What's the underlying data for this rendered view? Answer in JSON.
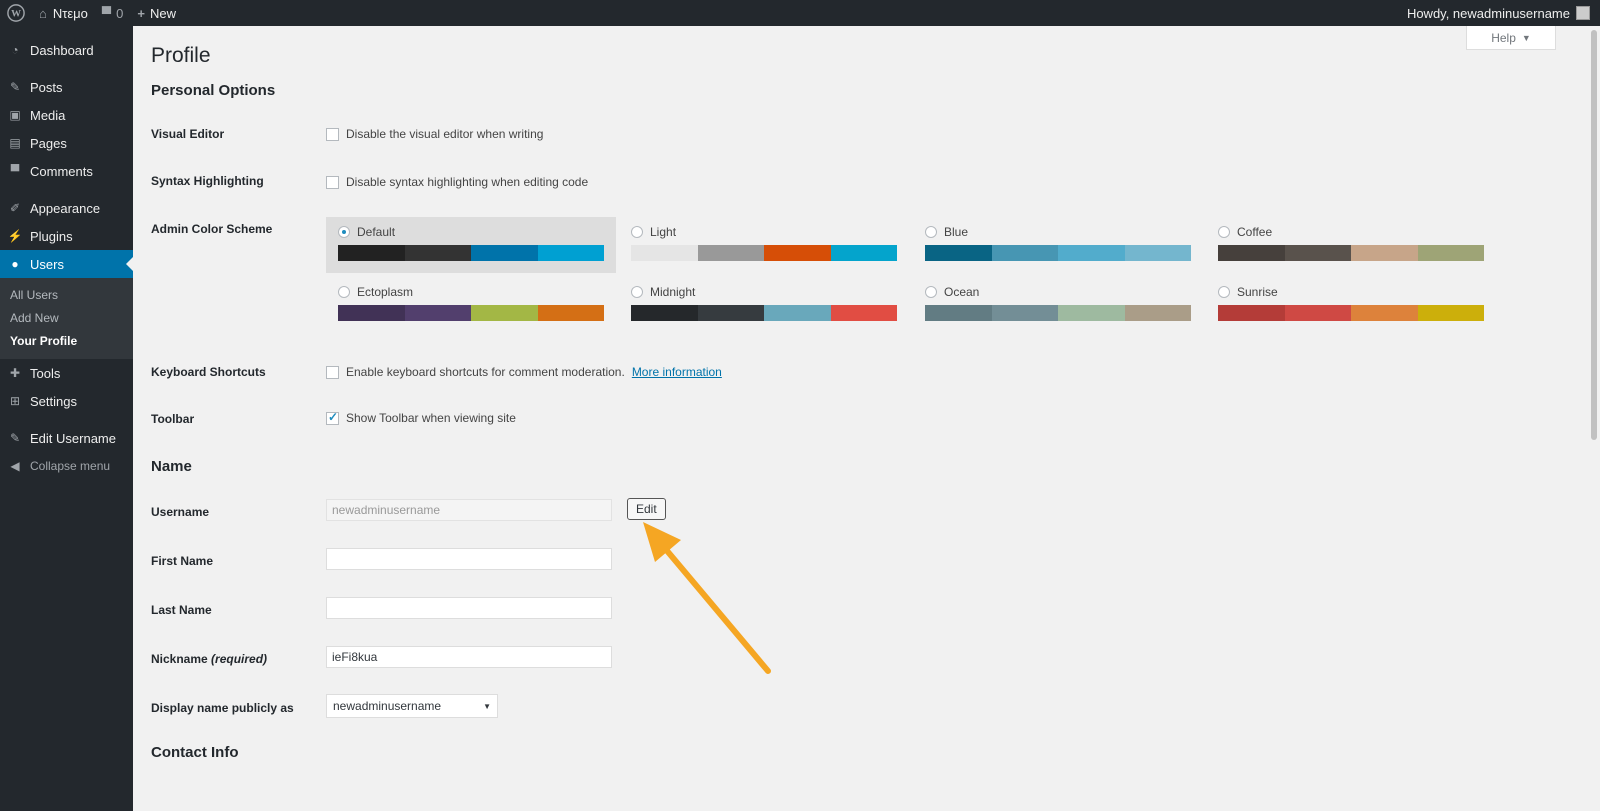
{
  "adminbar": {
    "site_name": "Ντεμο",
    "comments_count": "0",
    "new_label": "New",
    "howdy": "Howdy, newadminusername"
  },
  "sidebar": {
    "items": [
      {
        "label": "Dashboard",
        "icon": "dashboard-icon"
      },
      {
        "label": "Posts",
        "icon": "pin-icon"
      },
      {
        "label": "Media",
        "icon": "media-icon"
      },
      {
        "label": "Pages",
        "icon": "pages-icon"
      },
      {
        "label": "Comments",
        "icon": "comment-icon"
      },
      {
        "label": "Appearance",
        "icon": "brush-icon"
      },
      {
        "label": "Plugins",
        "icon": "plug-icon"
      },
      {
        "label": "Users",
        "icon": "user-icon"
      },
      {
        "label": "Tools",
        "icon": "wrench-icon"
      },
      {
        "label": "Settings",
        "icon": "settings-icon"
      },
      {
        "label": "Edit Username",
        "icon": "pencil-icon"
      },
      {
        "label": "Collapse menu",
        "icon": "collapse-icon"
      }
    ],
    "users_submenu": [
      "All Users",
      "Add New",
      "Your Profile"
    ]
  },
  "main": {
    "help_label": "Help",
    "page_title": "Profile",
    "personal_options_title": "Personal Options",
    "visual_editor": {
      "label": "Visual Editor",
      "option": "Disable the visual editor when writing"
    },
    "syntax_highlighting": {
      "label": "Syntax Highlighting",
      "option": "Disable syntax highlighting when editing code"
    },
    "color_scheme_label": "Admin Color Scheme",
    "schemes": [
      {
        "name": "Default",
        "colors": [
          "#222222",
          "#333333",
          "#0073aa",
          "#00a0d2"
        ],
        "selected": true
      },
      {
        "name": "Light",
        "colors": [
          "#e5e5e5",
          "#999999",
          "#d64e07",
          "#04a4cc"
        ],
        "selected": false
      },
      {
        "name": "Blue",
        "colors": [
          "#096484",
          "#4796b3",
          "#52accc",
          "#74b6ce"
        ],
        "selected": false
      },
      {
        "name": "Coffee",
        "colors": [
          "#46403c",
          "#59524c",
          "#c7a589",
          "#9ea476"
        ],
        "selected": false
      },
      {
        "name": "Ectoplasm",
        "colors": [
          "#413256",
          "#523f6d",
          "#a3b745",
          "#d46f15"
        ],
        "selected": false
      },
      {
        "name": "Midnight",
        "colors": [
          "#25282b",
          "#363b3f",
          "#69a8bb",
          "#e14d43"
        ],
        "selected": false
      },
      {
        "name": "Ocean",
        "colors": [
          "#627c83",
          "#738e96",
          "#9ebaa0",
          "#aa9d88"
        ],
        "selected": false
      },
      {
        "name": "Sunrise",
        "colors": [
          "#b43c38",
          "#cf4944",
          "#dd823b",
          "#ccaf0b"
        ],
        "selected": false
      }
    ],
    "keyboard_shortcuts": {
      "label": "Keyboard Shortcuts",
      "option": "Enable keyboard shortcuts for comment moderation.",
      "link": "More information"
    },
    "toolbar": {
      "label": "Toolbar",
      "option": "Show Toolbar when viewing site"
    },
    "name_title": "Name",
    "username": {
      "label": "Username",
      "value": "newadminusername",
      "edit_label": "Edit"
    },
    "first_name": {
      "label": "First Name",
      "value": ""
    },
    "last_name": {
      "label": "Last Name",
      "value": ""
    },
    "nickname": {
      "label": "Nickname",
      "required": "(required)",
      "value": "ieFi8kua"
    },
    "display_name": {
      "label": "Display name publicly as",
      "value": "newadminusername"
    },
    "contact_title": "Contact Info"
  },
  "colors": {
    "accent": "#0073aa",
    "arrow": "#f5a623"
  }
}
